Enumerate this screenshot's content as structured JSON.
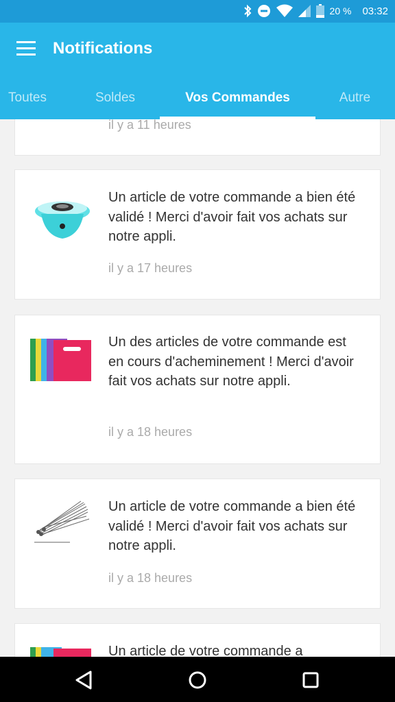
{
  "status_bar": {
    "battery_percent": "20 %",
    "time": "03:32",
    "icons": [
      "bluetooth-icon",
      "do-not-disturb-icon",
      "wifi-icon",
      "cell-signal-icon",
      "battery-icon"
    ]
  },
  "app_bar": {
    "title": "Notifications",
    "menu_icon": "hamburger-menu-icon"
  },
  "tabs": [
    {
      "label": "Toutes",
      "active": false
    },
    {
      "label": "Soldes",
      "active": false
    },
    {
      "label": "Vos Commandes",
      "active": true
    },
    {
      "label": "Autre",
      "active": false
    }
  ],
  "notifications": [
    {
      "message": "",
      "time": "il y a 11 heures"
    },
    {
      "message": "Un article de votre commande a bien été validé ! Merci d'avoir fait vos achats sur notre appli.",
      "time": "il y a 17 heures",
      "image": "cotton-candy-machine"
    },
    {
      "message": "Un des articles de votre commande est en cours d'acheminement ! Merci d'avoir fait vos achats sur notre appli.",
      "time": "il y a 18 heures",
      "image": "colorful-plastic-bags"
    },
    {
      "message": "Un article de votre commande a bien été validé ! Merci d'avoir fait vos achats sur notre appli.",
      "time": "il y a 18 heures",
      "image": "metal-skewers"
    },
    {
      "message": "Un article de votre commande a",
      "time": "",
      "image": "colorful-plastic-bags"
    }
  ],
  "nav_bar": {
    "buttons": [
      "back-icon",
      "home-icon",
      "recents-icon"
    ]
  },
  "colors": {
    "status_bar": "#1e9bd7",
    "app_bar": "#29b6e8",
    "background": "#f2f2f2"
  }
}
